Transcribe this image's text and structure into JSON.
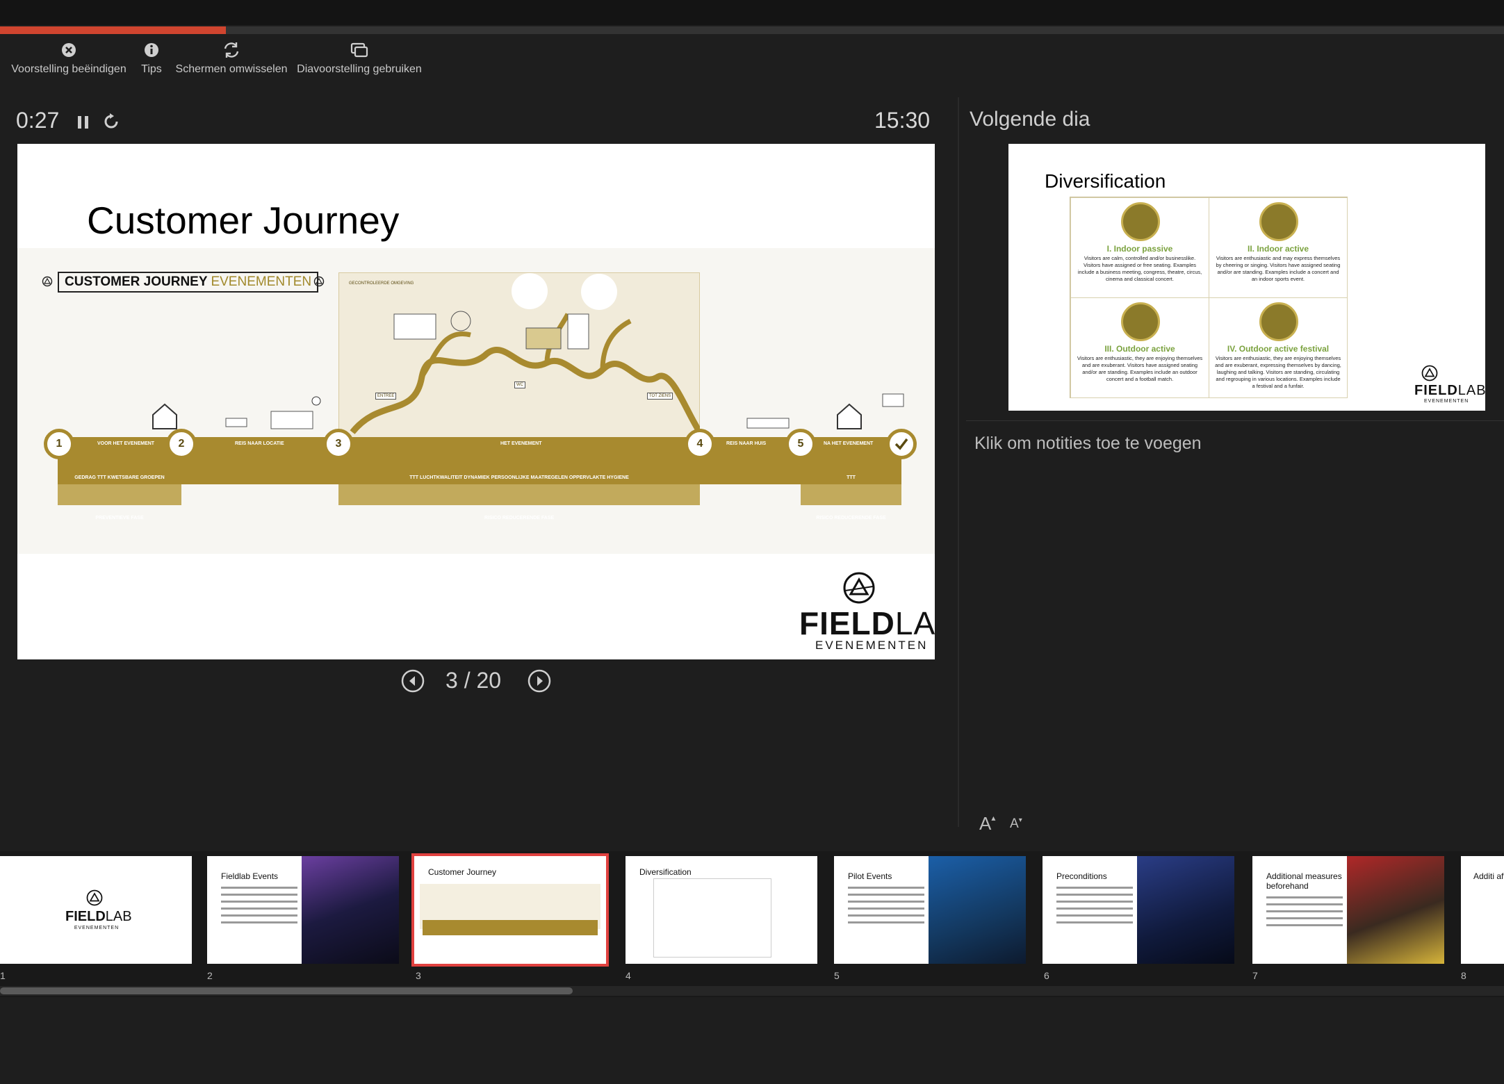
{
  "progress": {
    "fraction": 0.15
  },
  "toolbar": {
    "end": {
      "label": "Voorstelling beëindigen",
      "icon": "close-circle-icon"
    },
    "tips": {
      "label": "Tips",
      "icon": "info-icon"
    },
    "swap": {
      "label": "Schermen omwisselen",
      "icon": "swap-icon"
    },
    "slideshow": {
      "label": "Diavoorstelling gebruiken",
      "icon": "slideshow-icon"
    }
  },
  "timer": {
    "elapsed": "0:27",
    "clock": "15:30"
  },
  "current_slide": {
    "title": "Customer Journey",
    "graphic": {
      "heading_bold": "CUSTOMER JOURNEY",
      "heading_light": "EVENEMENTEN",
      "area_label": "GECONTROLEERDE OMGEVING",
      "nodes": [
        "1",
        "2",
        "3",
        "4",
        "5"
      ],
      "segments": [
        "VOOR HET EVENEMENT",
        "REIS NAAR LOCATIE",
        "HET EVENEMENT",
        "REIS NAAR HUIS",
        "NA HET EVENEMENT"
      ],
      "top_labels": [
        "GEDRAG   TTT   KWETSBARE GROEPEN",
        "TTT   LUCHTKWALITEIT   DYNAMIEK   PERSOONLIJKE MAATREGELEN   OPPERVLAKTE HYGIENE",
        "TTT"
      ],
      "bottom_labels": [
        "PREVENTIEVE FASE",
        "RISICO REDUCERENDE FASE",
        "RISICO REDUCERENDE FASE"
      ],
      "signs": [
        "ENTREE",
        "WC",
        "TOT ZIENS"
      ]
    },
    "logo": {
      "name_bold": "FIELD",
      "name_light": "LAB",
      "sub": "EVENEMENTEN"
    }
  },
  "slide_nav": {
    "text": "3 / 20"
  },
  "next_slide": {
    "label": "Volgende dia",
    "title": "Diversification",
    "cells": [
      {
        "title": "I. Indoor passive",
        "desc": "Visitors are calm, controlled and/or businesslike. Visitors have assigned or free seating. Examples include a business meeting, congress, theatre, circus, cinema and classical concert."
      },
      {
        "title": "II. Indoor active",
        "desc": "Visitors are enthusiastic and may express themselves by cheering or singing. Visitors have assigned seating and/or are standing. Examples include a concert and an indoor sports event."
      },
      {
        "title": "III. Outdoor active",
        "desc": "Visitors are enthusiastic, they are enjoying themselves and are exuberant. Visitors have assigned seating and/or are standing. Examples include an outdoor concert and a football match."
      },
      {
        "title": "IV. Outdoor active festival",
        "desc": "Visitors are enthusiastic, they are enjoying themselves and are exuberant, expressing themselves by dancing, laughing and talking. Visitors are standing, circulating and regrouping in various locations. Examples include a festival and a funfair."
      }
    ],
    "logo": {
      "name_bold": "FIELD",
      "name_light": "LAB",
      "sub": "EVENEMENTEN"
    }
  },
  "notes": {
    "placeholder": "Klik om notities toe te voegen"
  },
  "font_controls": {
    "increase": "A",
    "decrease": "A"
  },
  "thumbnails": [
    {
      "num": "1",
      "title": ""
    },
    {
      "num": "2",
      "title": "Fieldlab Events"
    },
    {
      "num": "3",
      "title": "Customer Journey"
    },
    {
      "num": "4",
      "title": "Diversification"
    },
    {
      "num": "5",
      "title": "Pilot Events"
    },
    {
      "num": "6",
      "title": "Preconditions"
    },
    {
      "num": "7",
      "title": "Additional measures beforehand"
    },
    {
      "num": "8",
      "title": "Additi afterwa"
    }
  ],
  "colors": {
    "accent_red": "#d0452f",
    "gold": "#a88a2f",
    "green_title": "#7ba23f"
  }
}
